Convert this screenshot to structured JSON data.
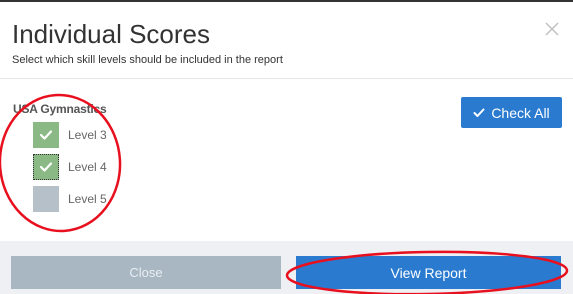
{
  "dialog": {
    "title": "Individual Scores",
    "subtitle": "Select which skill levels should be included in the report"
  },
  "group": {
    "label": "USA Gymnastics",
    "levels": [
      {
        "label": "Level 3",
        "checked": true
      },
      {
        "label": "Level 4",
        "checked": true
      },
      {
        "label": "Level 5",
        "checked": false
      }
    ]
  },
  "buttons": {
    "check_all": "Check All",
    "close": "Close",
    "view_report": "View Report"
  },
  "icons": {
    "close": "close-icon",
    "check": "checkmark-icon"
  },
  "colors": {
    "primary": "#2a7bd0",
    "checked_box": "#8bb985",
    "unchecked_box": "#b6c0c9",
    "close_button": "#a9b7c2",
    "annotation": "#e8101e"
  }
}
